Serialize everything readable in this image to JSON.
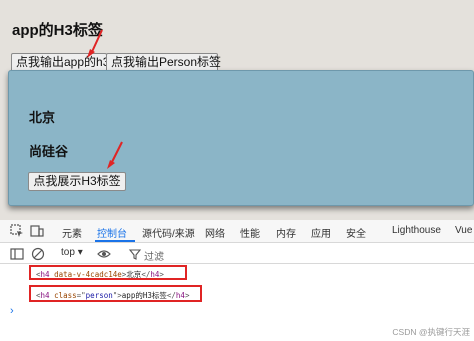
{
  "app": {
    "title": "app的H3标签",
    "btn_app": "点我输出app的h3",
    "btn_person": "点我输出Person标签"
  },
  "child": {
    "heading1": "北京",
    "heading2": "尚硅谷",
    "btn_show": "点我展示H3标签"
  },
  "devtools": {
    "tabs": [
      "元素",
      "控制台",
      "源代码/来源",
      "网络",
      "性能",
      "内存",
      "应用",
      "安全",
      "Lighthouse",
      "Vue"
    ],
    "active_tab": "控制台",
    "context": "top",
    "filter_placeholder": "过滤",
    "console_lines": [
      {
        "tag": "h4",
        "attr": "data-v-4cadc14e",
        "value": "",
        "text": "北京"
      },
      {
        "tag": "h4",
        "attr": "class",
        "value": "person",
        "text": "app的H3标签"
      }
    ],
    "prompt_symbol": "›"
  },
  "watermark": "CSDN @执键行天涯",
  "colors": {
    "accent": "#1a73e8",
    "annotation": "#e02424",
    "child_bg": "#8bb5c7"
  }
}
